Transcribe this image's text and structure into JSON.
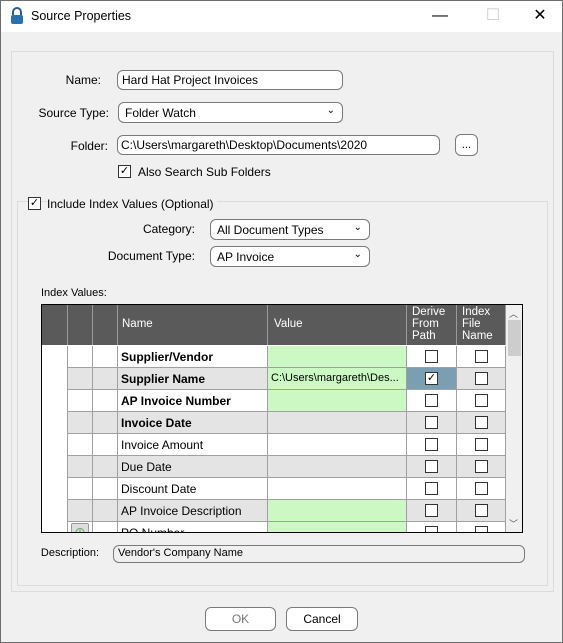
{
  "window": {
    "title": "Source Properties",
    "minimize": "—",
    "maximize": "☐",
    "close": "✕"
  },
  "form": {
    "name_label": "Name:",
    "name_value": "Hard Hat Project Invoices",
    "source_type_label": "Source Type:",
    "source_type_value": "Folder Watch",
    "folder_label": "Folder:",
    "folder_value": "C:\\Users\\margareth\\Desktop\\Documents\\2020",
    "browse_label": "...",
    "subfolders_label": "Also Search Sub Folders",
    "subfolders_checked": true,
    "include_index_label": "Include Index Values (Optional)",
    "include_index_checked": true,
    "category_label": "Category:",
    "category_value": "All Document Types",
    "doctype_label": "Document Type:",
    "doctype_value": "AP Invoice",
    "index_values_label": "Index Values:",
    "description_label": "Description:",
    "description_value": "Vendor's Company Name"
  },
  "grid": {
    "headers": {
      "name": "Name",
      "value": "Value",
      "derive": "Derive From Path",
      "index": "Index File Name"
    },
    "rows": [
      {
        "name": "Supplier/Vendor",
        "value": "",
        "bold": true,
        "required": true,
        "derive": false,
        "index": false
      },
      {
        "name": "Supplier Name",
        "value": "C:\\Users\\margareth\\Des...",
        "bold": true,
        "required": true,
        "derive": true,
        "index": false,
        "selected": true
      },
      {
        "name": "AP Invoice Number",
        "value": "",
        "bold": true,
        "required": true,
        "derive": false,
        "index": false
      },
      {
        "name": "Invoice Date",
        "value": "",
        "bold": true,
        "required": false,
        "derive": false,
        "index": false
      },
      {
        "name": "Invoice Amount",
        "value": "",
        "bold": false,
        "required": false,
        "derive": false,
        "index": false
      },
      {
        "name": "Due Date",
        "value": "",
        "bold": false,
        "required": false,
        "derive": false,
        "index": false
      },
      {
        "name": "Discount Date",
        "value": "",
        "bold": false,
        "required": false,
        "derive": false,
        "index": false
      },
      {
        "name": "AP Invoice Description",
        "value": "",
        "bold": false,
        "required": true,
        "derive": false,
        "index": false
      },
      {
        "name": "PO Number",
        "value": "",
        "bold": false,
        "required": true,
        "derive": false,
        "index": false
      }
    ]
  },
  "buttons": {
    "ok": "OK",
    "cancel": "Cancel"
  },
  "colors": {
    "required": "#ccf8c4",
    "selected": "#7b9fb2",
    "header": "#5a5a5a",
    "alt_row": "#e4e4e4"
  }
}
